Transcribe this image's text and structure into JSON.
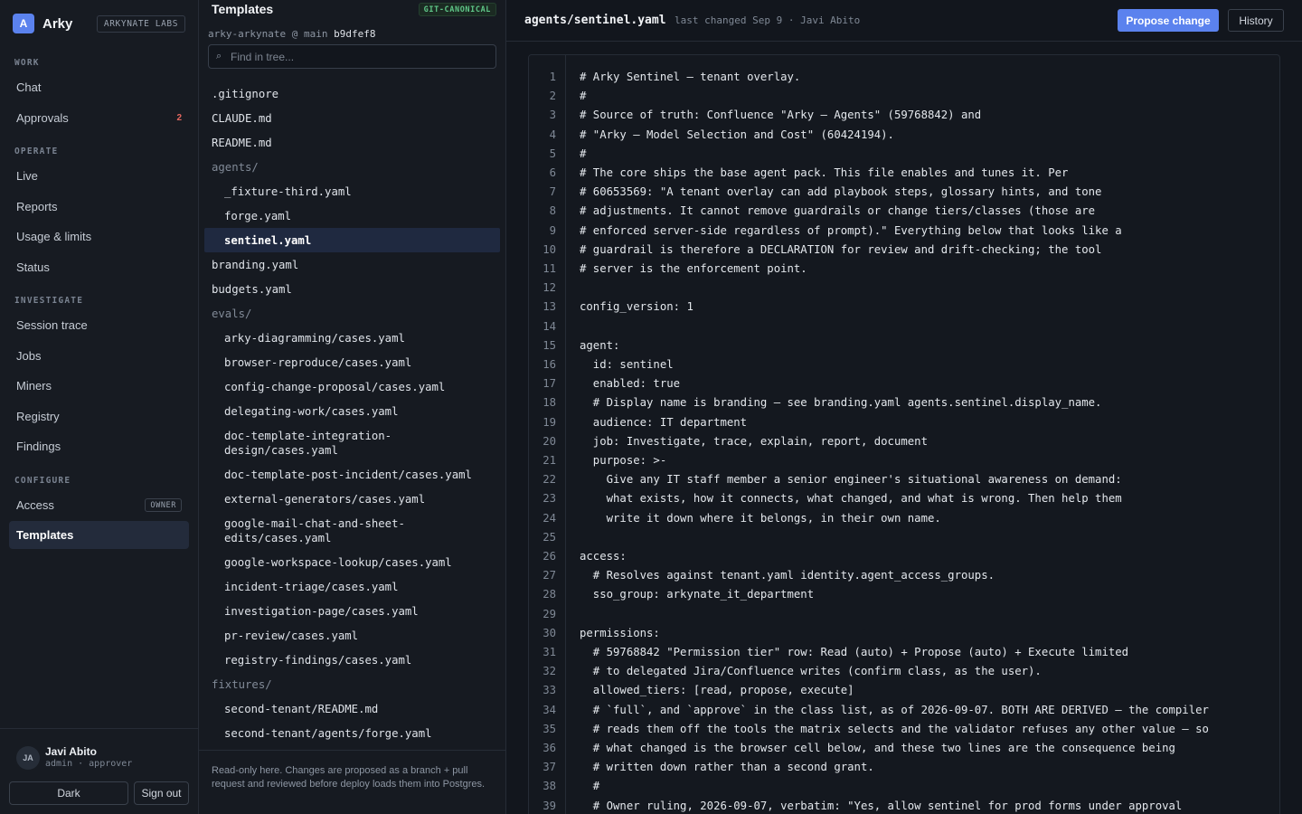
{
  "brand": {
    "mark": "A",
    "name": "Arky",
    "org": "ARKYNATE LABS"
  },
  "nav": {
    "sections": [
      {
        "label": "WORK",
        "items": [
          {
            "label": "Chat"
          },
          {
            "label": "Approvals",
            "count": "2"
          }
        ]
      },
      {
        "label": "OPERATE",
        "items": [
          {
            "label": "Live"
          },
          {
            "label": "Reports"
          },
          {
            "label": "Usage & limits"
          },
          {
            "label": "Status"
          }
        ]
      },
      {
        "label": "INVESTIGATE",
        "items": [
          {
            "label": "Session trace"
          },
          {
            "label": "Jobs"
          },
          {
            "label": "Miners"
          },
          {
            "label": "Registry"
          },
          {
            "label": "Findings"
          }
        ]
      },
      {
        "label": "CONFIGURE",
        "items": [
          {
            "label": "Access",
            "tag": "OWNER"
          },
          {
            "label": "Templates",
            "active": true
          }
        ]
      }
    ]
  },
  "user": {
    "initials": "JA",
    "name": "Javi Abito",
    "role": "admin · approver"
  },
  "sidebar_actions": {
    "theme": "Dark",
    "signout": "Sign out"
  },
  "tree": {
    "title": "Templates",
    "badge": "GIT-CANONICAL",
    "repo": "arky-arkynate @ main",
    "sha": "b9dfef8",
    "search_placeholder": "Find in tree...",
    "rows": [
      {
        "label": ".gitignore",
        "kind": "file",
        "depth": 0
      },
      {
        "label": "CLAUDE.md",
        "kind": "file",
        "depth": 0
      },
      {
        "label": "README.md",
        "kind": "file",
        "depth": 0
      },
      {
        "label": "agents/",
        "kind": "dir",
        "depth": 0
      },
      {
        "label": "_fixture-third.yaml",
        "kind": "file",
        "depth": 1
      },
      {
        "label": "forge.yaml",
        "kind": "file",
        "depth": 1
      },
      {
        "label": "sentinel.yaml",
        "kind": "file",
        "depth": 1,
        "selected": true
      },
      {
        "label": "branding.yaml",
        "kind": "file",
        "depth": 0
      },
      {
        "label": "budgets.yaml",
        "kind": "file",
        "depth": 0
      },
      {
        "label": "evals/",
        "kind": "dir",
        "depth": 0
      },
      {
        "label": "arky-diagramming/cases.yaml",
        "kind": "file",
        "depth": 1
      },
      {
        "label": "browser-reproduce/cases.yaml",
        "kind": "file",
        "depth": 1
      },
      {
        "label": "config-change-proposal/cases.yaml",
        "kind": "file",
        "depth": 1
      },
      {
        "label": "delegating-work/cases.yaml",
        "kind": "file",
        "depth": 1
      },
      {
        "label": "doc-template-integration-\ndesign/cases.yaml",
        "kind": "file",
        "depth": 1,
        "wrap": true
      },
      {
        "label": "doc-template-post-incident/cases.yaml",
        "kind": "file",
        "depth": 1
      },
      {
        "label": "external-generators/cases.yaml",
        "kind": "file",
        "depth": 1
      },
      {
        "label": "google-mail-chat-and-sheet-\nedits/cases.yaml",
        "kind": "file",
        "depth": 1,
        "wrap": true
      },
      {
        "label": "google-workspace-lookup/cases.yaml",
        "kind": "file",
        "depth": 1
      },
      {
        "label": "incident-triage/cases.yaml",
        "kind": "file",
        "depth": 1
      },
      {
        "label": "investigation-page/cases.yaml",
        "kind": "file",
        "depth": 1
      },
      {
        "label": "pr-review/cases.yaml",
        "kind": "file",
        "depth": 1
      },
      {
        "label": "registry-findings/cases.yaml",
        "kind": "file",
        "depth": 1
      },
      {
        "label": "fixtures/",
        "kind": "dir",
        "depth": 0
      },
      {
        "label": "second-tenant/README.md",
        "kind": "file",
        "depth": 1
      },
      {
        "label": "second-tenant/agents/forge.yaml",
        "kind": "file",
        "depth": 1
      }
    ],
    "footer": "Read-only here. Changes are proposed as a branch + pull request and reviewed before deploy loads them into Postgres."
  },
  "file": {
    "path": "agents/sentinel.yaml",
    "meta": "last changed Sep 9 · Javi Abito",
    "propose_label": "Propose change",
    "history_label": "History",
    "lines": [
      "# Arky Sentinel — tenant overlay.",
      "#",
      "# Source of truth: Confluence \"Arky — Agents\" (59768842) and",
      "# \"Arky — Model Selection and Cost\" (60424194).",
      "#",
      "# The core ships the base agent pack. This file enables and tunes it. Per",
      "# 60653569: \"A tenant overlay can add playbook steps, glossary hints, and tone",
      "# adjustments. It cannot remove guardrails or change tiers/classes (those are",
      "# enforced server-side regardless of prompt).\" Everything below that looks like a",
      "# guardrail is therefore a DECLARATION for review and drift-checking; the tool",
      "# server is the enforcement point.",
      "",
      "config_version: 1",
      "",
      "agent:",
      "  id: sentinel",
      "  enabled: true",
      "  # Display name is branding — see branding.yaml agents.sentinel.display_name.",
      "  audience: IT department",
      "  job: Investigate, trace, explain, report, document",
      "  purpose: >-",
      "    Give any IT staff member a senior engineer's situational awareness on demand:",
      "    what exists, how it connects, what changed, and what is wrong. Then help them",
      "    write it down where it belongs, in their own name.",
      "",
      "access:",
      "  # Resolves against tenant.yaml identity.agent_access_groups.",
      "  sso_group: arkynate_it_department",
      "",
      "permissions:",
      "  # 59768842 \"Permission tier\" row: Read (auto) + Propose (auto) + Execute limited",
      "  # to delegated Jira/Confluence writes (confirm class, as the user).",
      "  allowed_tiers: [read, propose, execute]",
      "  # `full`, and `approve` in the class list, as of 2026-09-07. BOTH ARE DERIVED — the compiler",
      "  # reads them off the tools the matrix selects and the validator refuses any other value — so",
      "  # what changed is the browser cell below, and these two lines are the consequence being",
      "  # written down rather than a second grant.",
      "  #",
      "  # Owner ruling, 2026-09-07, verbatim: \"Yes, allow sentinel for prod forms under approval"
    ]
  }
}
